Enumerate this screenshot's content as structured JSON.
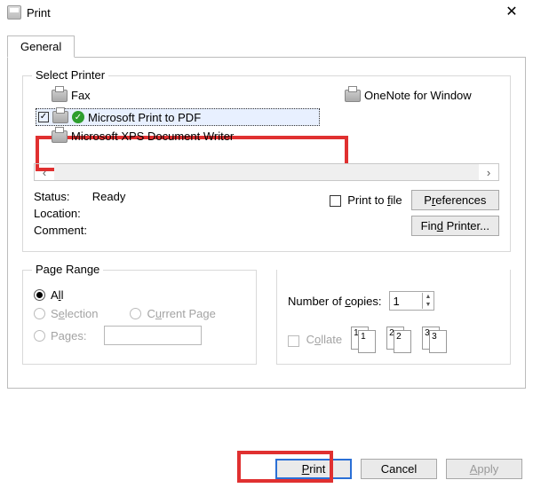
{
  "window": {
    "title": "Print",
    "close": "✕"
  },
  "tabs": {
    "general": "General"
  },
  "group_select_printer": {
    "legend": "Select Printer",
    "items": {
      "fax": "Fax",
      "mspdf": "Microsoft Print to PDF",
      "xps": "Microsoft XPS Document Writer",
      "onenote": "OneNote for Window"
    },
    "scroll_left": "‹",
    "scroll_right": "›",
    "status_label": "Status:",
    "status_value": "Ready",
    "location_label": "Location:",
    "comment_label": "Comment:",
    "print_to_file": "Print to file",
    "btn_prefs": "Preferences",
    "btn_find": "Find Printer..."
  },
  "group_page_range": {
    "legend": "Page Range",
    "opt_all": "All",
    "opt_selection": "Selection",
    "opt_current": "Current Page",
    "opt_pages": "Pages:"
  },
  "copies": {
    "label": "Number of copies:",
    "value": "1",
    "collate": "Collate",
    "pairs": [
      "1",
      "2",
      "3"
    ]
  },
  "buttons": {
    "print": "Print",
    "cancel": "Cancel",
    "apply": "Apply"
  }
}
